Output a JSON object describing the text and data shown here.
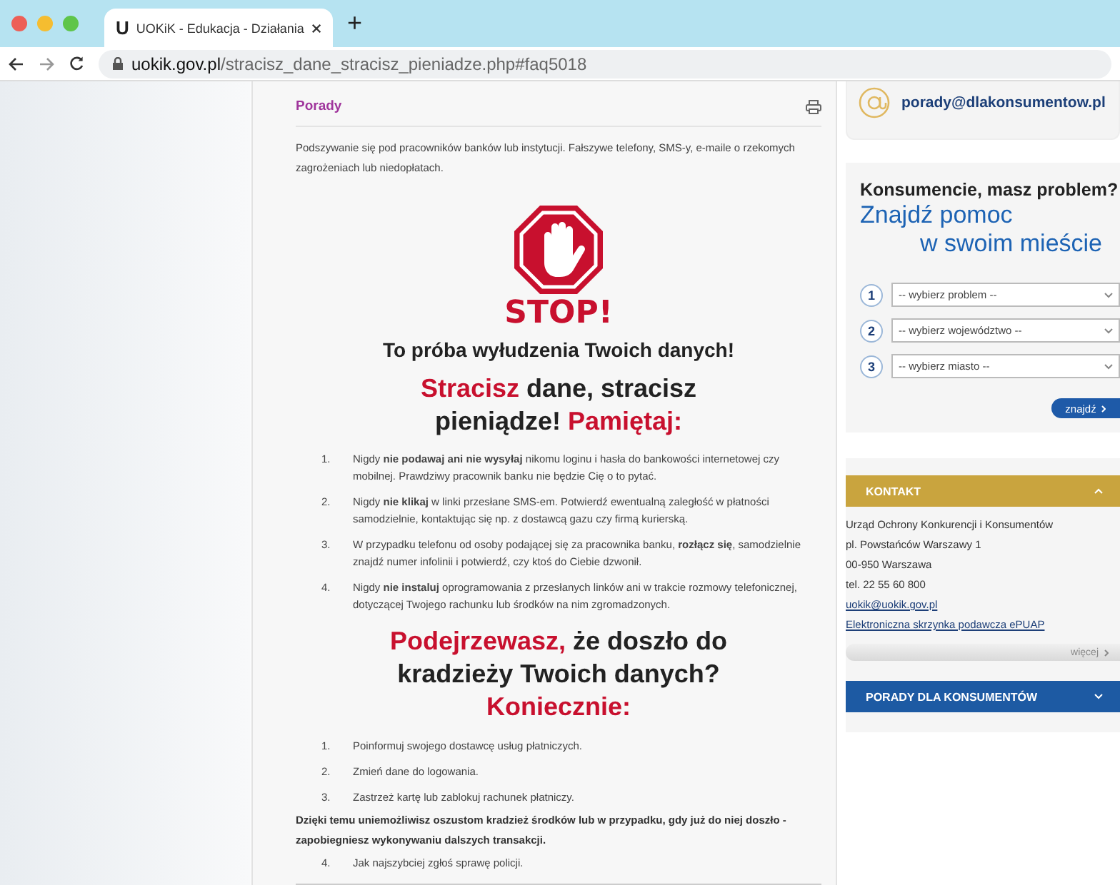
{
  "browser": {
    "tab_title": "UOKiK - Edukacja - Działania",
    "tab_icon": "U",
    "new_tab": "+",
    "url_domain": "uokik.gov.pl",
    "url_path": "/stracisz_dane_stracisz_pieniadze.php#faq5018"
  },
  "article": {
    "section": "Porady",
    "intro": "Podszywanie się pod pracowników banków lub instytucji. Fałszywe telefony, SMS-y, e-maile o rzekomych zagrożeniach lub niedopłatach.",
    "stop": "STOP!",
    "subtitle": "To próba wyłudzenia Twoich danych!",
    "heading1": [
      {
        "text": "Stracisz",
        "accent": true
      },
      {
        "text": " dane, stracisz pieniądze! ",
        "accent": false
      },
      {
        "text": "Pamiętaj:",
        "accent": true
      }
    ],
    "list1": [
      {
        "num": "1.",
        "text": "Nigdy **nie podawaj ani nie wysyłaj** nikomu loginu i hasła do bankowości internetowej czy mobilnej. Prawdziwy pracownik banku nie będzie Cię o to pytać."
      },
      {
        "num": "2.",
        "text": "Nigdy **nie klikaj** w linki przesłane SMS-em. Potwierdź ewentualną zaległość w płatności samodzielnie, kontaktując się np. z dostawcą gazu czy firmą kurierską."
      },
      {
        "num": "3.",
        "text": "W przypadku telefonu od osoby podającej się za pracownika banku, **rozłącz się**, samodzielnie znajdź numer infolinii i potwierdź, czy ktoś do Ciebie dzwonił."
      },
      {
        "num": "4.",
        "text": "Nigdy **nie instaluj** oprogramowania z przesłanych linków ani w trakcie rozmowy telefonicznej, dotyczącej Twojego rachunku lub środków na nim zgromadzonych."
      }
    ],
    "heading2": [
      {
        "text": "Podejrzewasz,",
        "accent": true
      },
      {
        "text": " że doszło do kradzieży Twoich danych? ",
        "accent": false
      },
      {
        "text": "Koniecznie:",
        "accent": true
      }
    ],
    "list2": [
      {
        "num": "1.",
        "text": "Poinformuj swojego dostawcę usług płatniczych."
      },
      {
        "num": "2.",
        "text": "Zmień dane do logowania."
      },
      {
        "num": "3.",
        "text": "Zastrzeż kartę lub zablokuj rachunek płatniczy."
      }
    ],
    "note": "Dzięki temu uniemożliwisz oszustom kradzież środków lub w przypadku, gdy już do niej doszło - zapobiegniesz wykonywaniu dalszych transakcji.",
    "list3": [
      {
        "num": "4.",
        "text": "Jak najszybciej zgłoś sprawę policji."
      }
    ]
  },
  "sidebar": {
    "email": "porady@dlakonsumentow.pl",
    "finder_title": "Konsumencie, masz problem?",
    "finder_line1": "Znajdź pomoc",
    "finder_line2": "w swoim mieście",
    "selects": [
      {
        "num": "1",
        "placeholder": "-- wybierz problem --"
      },
      {
        "num": "2",
        "placeholder": "-- wybierz województwo --"
      },
      {
        "num": "3",
        "placeholder": "-- wybierz miasto --"
      }
    ],
    "find_button": "znajdź",
    "contact": {
      "title": "KONTAKT",
      "expanded": true,
      "lines": [
        "Urząd Ochrony Konkurencji i Konsumentów",
        "pl. Powstańców Warszawy 1",
        "00-950 Warszawa",
        "tel. 22 55 60 800"
      ],
      "links": [
        "uokik@uokik.gov.pl",
        "Elektroniczna skrzynka podawcza ePUAP"
      ],
      "more": "więcej"
    },
    "advice": {
      "title": "PORADY DLA KONSUMENTÓW",
      "expanded": false
    }
  }
}
